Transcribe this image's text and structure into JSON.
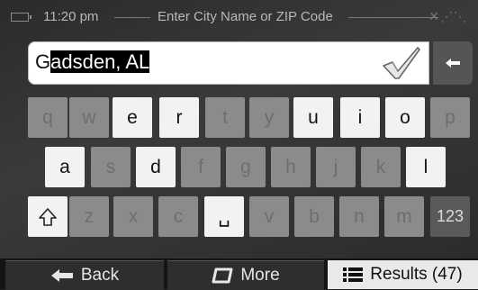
{
  "header": {
    "time": "11:20 pm",
    "title": "Enter City Name or ZIP Code"
  },
  "input": {
    "typed": "G",
    "suggested": "adsden, AL"
  },
  "keyboard": {
    "row1": [
      "q",
      "w",
      "e",
      "r",
      "t",
      "y",
      "u",
      "i",
      "o",
      "p"
    ],
    "row2": [
      "a",
      "s",
      "d",
      "f",
      "g",
      "h",
      "j",
      "k",
      "l"
    ],
    "row3": [
      "z",
      "x",
      "c",
      "v",
      "b",
      "n",
      "m"
    ],
    "space": "␣",
    "numbers_label": "123"
  },
  "footer": {
    "back_label": "Back",
    "more_label": "More",
    "results_label": "Results (47)"
  }
}
